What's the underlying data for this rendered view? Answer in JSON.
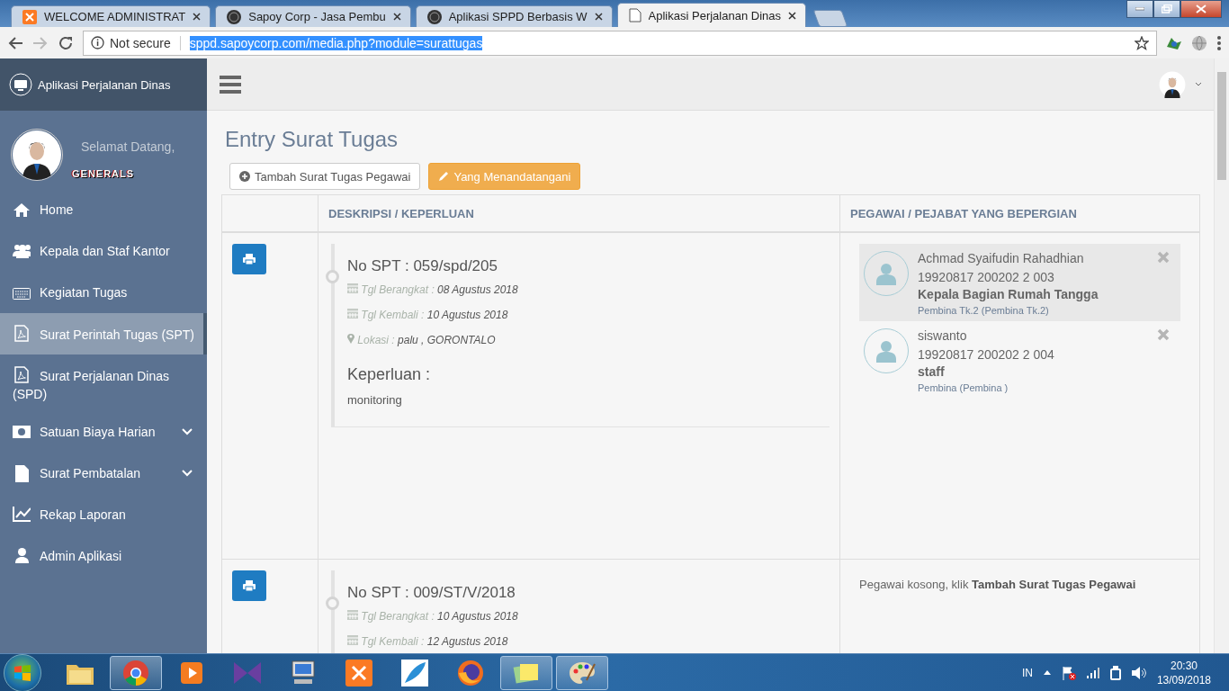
{
  "browser": {
    "tabs": [
      {
        "title": "WELCOME ADMINISTRAT",
        "kind": "xampp",
        "selected": false
      },
      {
        "title": "Sapoy Corp - Jasa Pembu",
        "kind": "globe",
        "selected": false
      },
      {
        "title": "Aplikasi SPPD Berbasis W",
        "kind": "globe",
        "selected": false
      },
      {
        "title": "Aplikasi Perjalanan Dinas",
        "kind": "page",
        "selected": true
      }
    ],
    "security": "Not secure",
    "url": "sppd.sapoycorp.com/media.php?module=surattugas",
    "url_selected": true
  },
  "sidebar": {
    "brand": "Aplikasi Perjalanan Dinas",
    "welcome": "Selamat Datang,",
    "username": "GENERALS",
    "items": [
      {
        "label": "Home",
        "kind": "home",
        "selected": false,
        "expandable": false
      },
      {
        "label": "Kepala dan Staf Kantor",
        "kind": "users",
        "selected": false,
        "expandable": false
      },
      {
        "label": "Kegiatan Tugas",
        "kind": "keyboard",
        "selected": false,
        "expandable": false
      },
      {
        "label": "Surat Perintah Tugas (SPT)",
        "kind": "pdf",
        "selected": true,
        "expandable": false
      },
      {
        "label": "Surat Perjalanan Dinas (SPD)",
        "kind": "pdf",
        "selected": false,
        "expandable": false
      },
      {
        "label": "Satuan Biaya Harian",
        "kind": "money",
        "selected": false,
        "expandable": true
      },
      {
        "label": "Surat Pembatalan",
        "kind": "file",
        "selected": false,
        "expandable": true
      },
      {
        "label": "Rekap Laporan",
        "kind": "chart",
        "selected": false,
        "expandable": false
      },
      {
        "label": "Admin Aplikasi",
        "kind": "user",
        "selected": false,
        "expandable": false
      }
    ]
  },
  "page": {
    "title": "Entry Surat Tugas",
    "buttons": [
      {
        "label": "Tambah Surat Tugas Pegawai",
        "kind": "add"
      },
      {
        "label": "Yang Menandatangani",
        "kind": "edit"
      }
    ],
    "table": {
      "columns": [
        "DESKRIPSI / KEPERLUAN",
        "PEGAWAI / PEJABAT YANG BEPERGIAN"
      ],
      "rows": [
        {
          "no_spt": "No SPT : 059/spd/205",
          "details": [
            {
              "kind": "date",
              "label": "Tgl Berangkat :",
              "value": "08 Agustus 2018"
            },
            {
              "kind": "date",
              "label": "Tgl Kembali :",
              "value": "10 Agustus 2018"
            },
            {
              "kind": "location",
              "label": "Lokasi :",
              "value": "palu , GORONTALO"
            }
          ],
          "keperluan_label": "Keperluan :",
          "keperluan": "monitoring",
          "employees": [
            {
              "name": "Achmad Syaifudin Rahadhian",
              "nip": "19920817 200202 2 003",
              "position": "Kepala Bagian Rumah Tangga",
              "rank": "Pembina Tk.2 (Pembina Tk.2)",
              "highlighted": true
            },
            {
              "name": "siswanto",
              "nip": "19920817 200202 2 004",
              "position": "staff",
              "rank": "Pembina (Pembina )",
              "highlighted": false
            }
          ]
        },
        {
          "no_spt": "No SPT : 009/ST/V/2018",
          "details": [
            {
              "kind": "date",
              "label": "Tgl Berangkat :",
              "value": "10 Agustus 2018"
            },
            {
              "kind": "date",
              "label": "Tgl Kembali :",
              "value": "12 Agustus 2018"
            }
          ],
          "empty_note": "Pegawai kosong, klik **Tambah Surat Tugas Pegawai**"
        }
      ]
    }
  },
  "taskbar": {
    "apps": [
      {
        "kind": "folder",
        "running": false
      },
      {
        "kind": "chrome",
        "running": true
      },
      {
        "kind": "player",
        "running": false
      },
      {
        "kind": "bowtie",
        "running": false
      },
      {
        "kind": "computer",
        "running": false
      },
      {
        "kind": "xampp",
        "running": false
      },
      {
        "kind": "feather",
        "running": false
      },
      {
        "kind": "firefox",
        "running": false
      },
      {
        "kind": "notes",
        "running": true
      },
      {
        "kind": "paint",
        "running": true
      }
    ],
    "language": "IN",
    "time": "20:30",
    "date": "13/09/2018"
  }
}
